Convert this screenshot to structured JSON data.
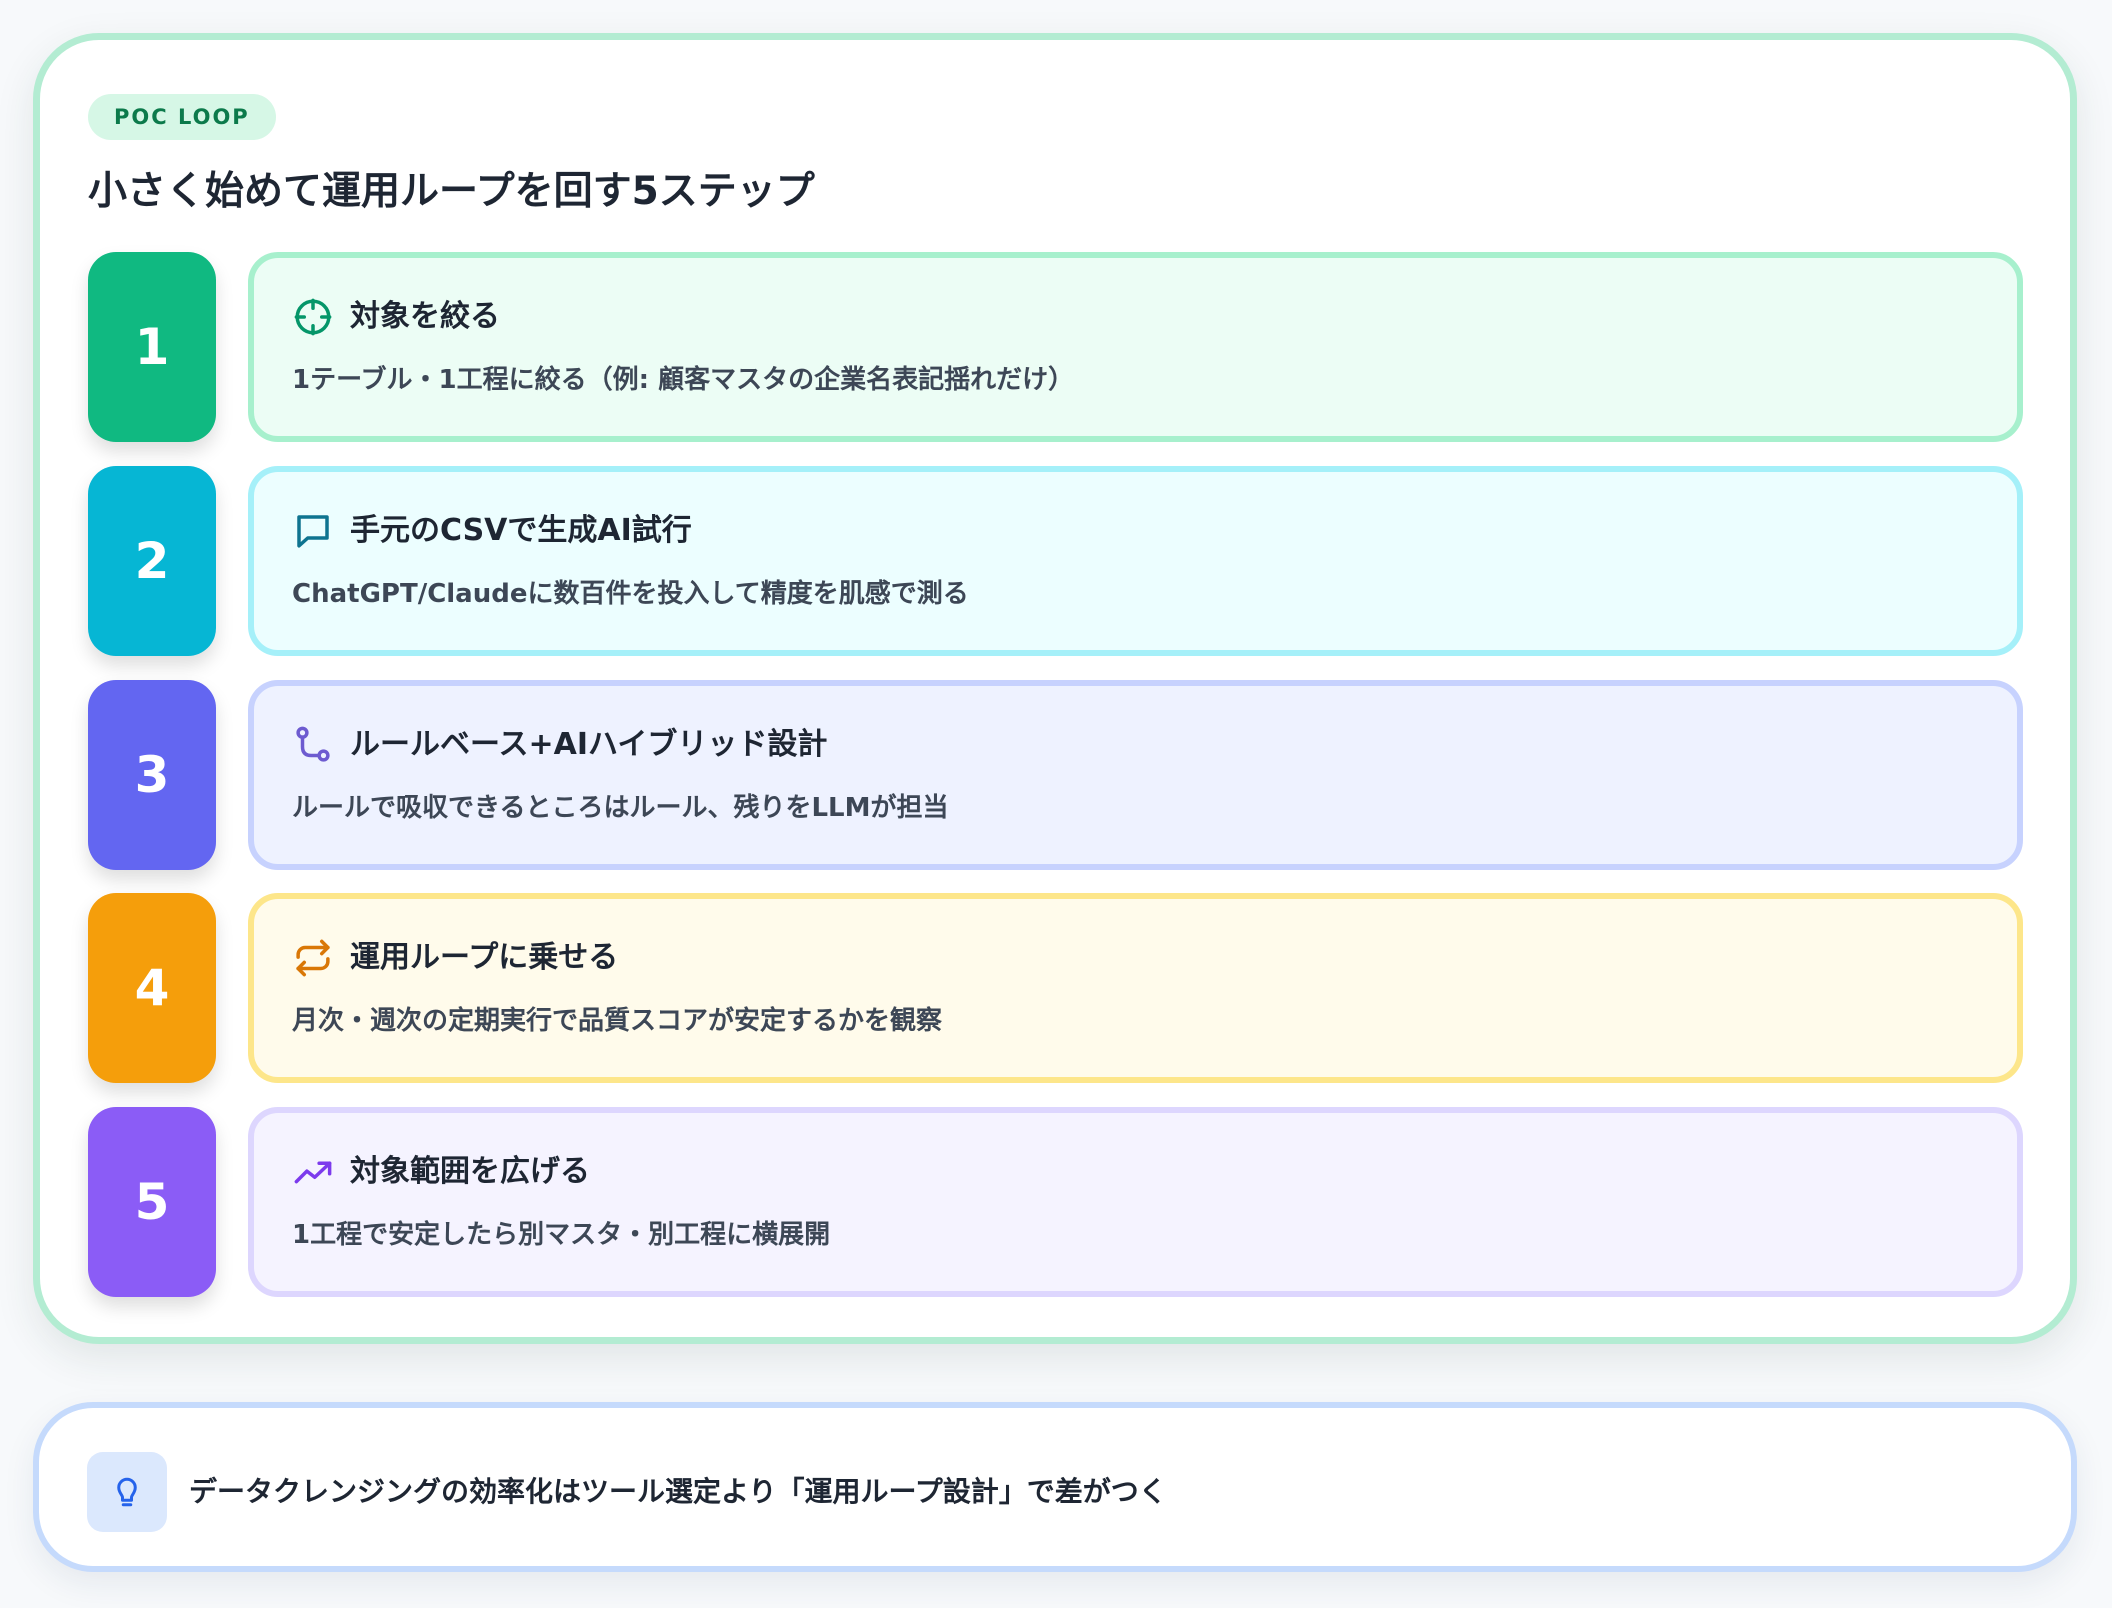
{
  "tag": "POC LOOP",
  "title": "小さく始めて運用ループを回す5ステップ",
  "steps": [
    {
      "number": "1",
      "title": "対象を絞る",
      "description": "1テーブル・1工程に絞る（例: 顧客マスタの企業名表記揺れだけ）",
      "icon": "crosshair-icon",
      "accent": "#10b981",
      "card_bg": "#ecfdf5",
      "card_border": "#a7f0cd",
      "icon_color": "#059669"
    },
    {
      "number": "2",
      "title": "手元のCSVで生成AI試行",
      "description": "ChatGPT/Claudeに数百件を投入して精度を肌感で測る",
      "icon": "chat-icon",
      "accent": "#06b6d4",
      "card_bg": "#ecfeff",
      "card_border": "#a5f0f9",
      "icon_color": "#0e7490"
    },
    {
      "number": "3",
      "title": "ルールベース+AIハイブリッド設計",
      "description": "ルールで吸収できるところはルール、残りをLLMが担当",
      "icon": "route-icon",
      "accent": "#6366f1",
      "card_bg": "#eef2ff",
      "card_border": "#c7d2fe",
      "icon_color": "#6d5bd0"
    },
    {
      "number": "4",
      "title": "運用ループに乗せる",
      "description": "月次・週次の定期実行で品質スコアが安定するかを観察",
      "icon": "repeat-icon",
      "accent": "#f59e0b",
      "card_bg": "#fffbeb",
      "card_border": "#fde68a",
      "icon_color": "#d97706"
    },
    {
      "number": "5",
      "title": "対象範囲を広げる",
      "description": "1工程で安定したら別マスタ・別工程に横展開",
      "icon": "trending-up-icon",
      "accent": "#8b5cf6",
      "card_bg": "#f5f3ff",
      "card_border": "#ddd6fe",
      "icon_color": "#7c3aed"
    }
  ],
  "tip": {
    "icon": "lightbulb-icon",
    "text": "データクレンジングの効率化はツール選定より「運用ループ設計」で差がつく"
  }
}
